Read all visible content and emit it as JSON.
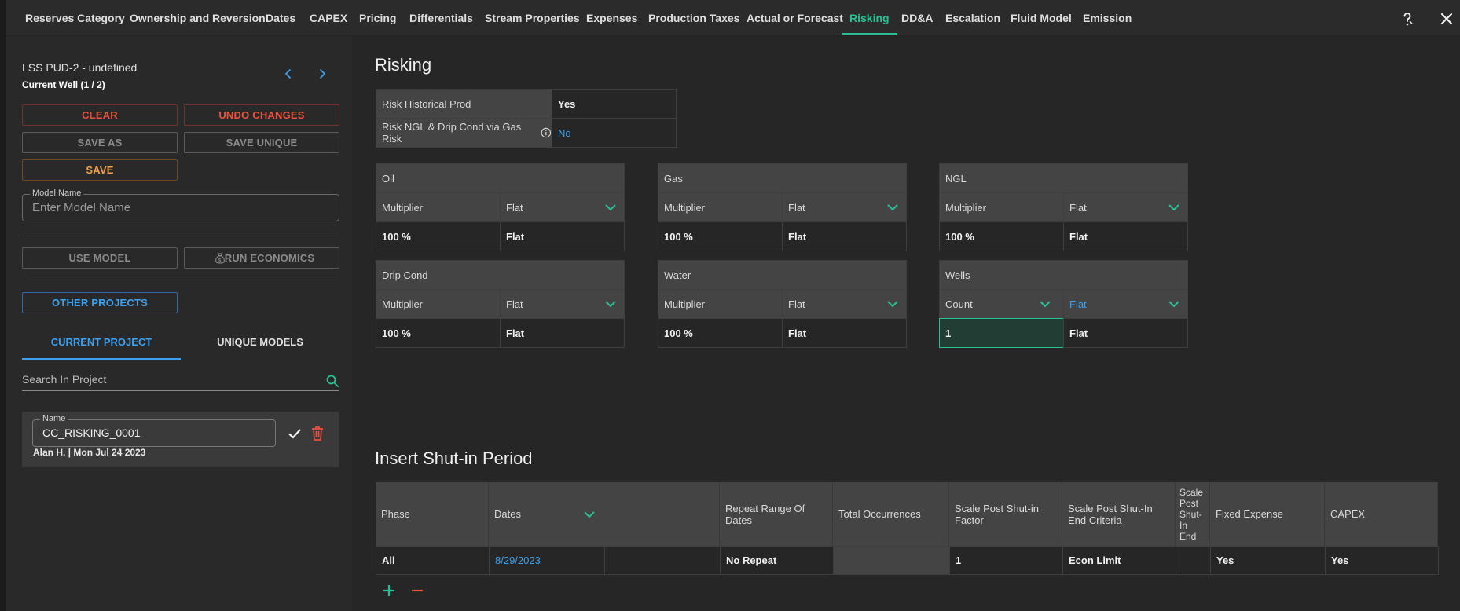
{
  "tabs": [
    {
      "label": "Reserves Category",
      "active": false
    },
    {
      "label": "Ownership and Reversion",
      "active": false
    },
    {
      "label": "Dates",
      "active": false
    },
    {
      "label": "CAPEX",
      "active": false
    },
    {
      "label": "Pricing",
      "active": false
    },
    {
      "label": "Differentials",
      "active": false
    },
    {
      "label": "Stream Properties",
      "active": false
    },
    {
      "label": "Expenses",
      "active": false
    },
    {
      "label": "Production Taxes",
      "active": false
    },
    {
      "label": "Actual or Forecast",
      "active": false
    },
    {
      "label": "Risking",
      "active": true
    },
    {
      "label": "DD&A",
      "active": false
    },
    {
      "label": "Escalation",
      "active": false
    },
    {
      "label": "Fluid Model",
      "active": false
    },
    {
      "label": "Emission",
      "active": false
    }
  ],
  "accent_color": "#2bbf95",
  "left": {
    "well_name": "LSS PUD-2 - undefined",
    "current_well": "Current Well (1 / 2)",
    "buttons": {
      "clear": "CLEAR",
      "undo": "UNDO CHANGES",
      "save_as": "SAVE AS",
      "save_unique": "SAVE UNIQUE",
      "save": "SAVE",
      "use_model": "USE MODEL",
      "run_economics": "RUN ECONOMICS",
      "other_projects": "OTHER PROJECTS"
    },
    "model_name": {
      "label": "Model Name",
      "placeholder": "Enter Model Name"
    },
    "project_tabs": {
      "current": "CURRENT PROJECT",
      "unique": "UNIQUE MODELS"
    },
    "search_placeholder": "Search In Project",
    "model_card": {
      "label": "Name",
      "value": "CC_RISKING_0001",
      "meta": "Alan H. | Mon Jul 24 2023"
    }
  },
  "risking": {
    "title": "Risking",
    "settings": [
      {
        "label": "Risk Historical Prod",
        "value": "Yes"
      },
      {
        "label": "Risk NGL & Drip Cond via Gas Risk",
        "value": "No"
      }
    ],
    "phases": [
      {
        "name": "Oil",
        "type": "Multiplier",
        "mode": "Flat",
        "value": "100 %",
        "criteria": "Flat"
      },
      {
        "name": "Gas",
        "type": "Multiplier",
        "mode": "Flat",
        "value": "100 %",
        "criteria": "Flat"
      },
      {
        "name": "NGL",
        "type": "Multiplier",
        "mode": "Flat",
        "value": "100 %",
        "criteria": "Flat"
      },
      {
        "name": "Drip Cond",
        "type": "Multiplier",
        "mode": "Flat",
        "value": "100 %",
        "criteria": "Flat"
      },
      {
        "name": "Water",
        "type": "Multiplier",
        "mode": "Flat",
        "value": "100 %",
        "criteria": "Flat"
      },
      {
        "name": "Wells",
        "type": "Count",
        "mode": "Flat",
        "value": "1",
        "criteria": "Flat"
      }
    ]
  },
  "shutin": {
    "title": "Insert Shut-in Period",
    "headers": [
      "Phase",
      "Dates",
      "Repeat Range Of Dates",
      "Total Occurrences",
      "Scale Post Shut-in Factor",
      "Scale Post Shut-In End Criteria",
      "Scale Post Shut-In End",
      "Fixed Expense",
      "CAPEX"
    ],
    "row": {
      "phase": "All",
      "start": "8/29/2023",
      "end": "",
      "repeat": "No Repeat",
      "occurrences": "",
      "factor": "1",
      "criteria": "Econ Limit",
      "fixed_expense": "Yes",
      "capex": "Yes"
    }
  }
}
